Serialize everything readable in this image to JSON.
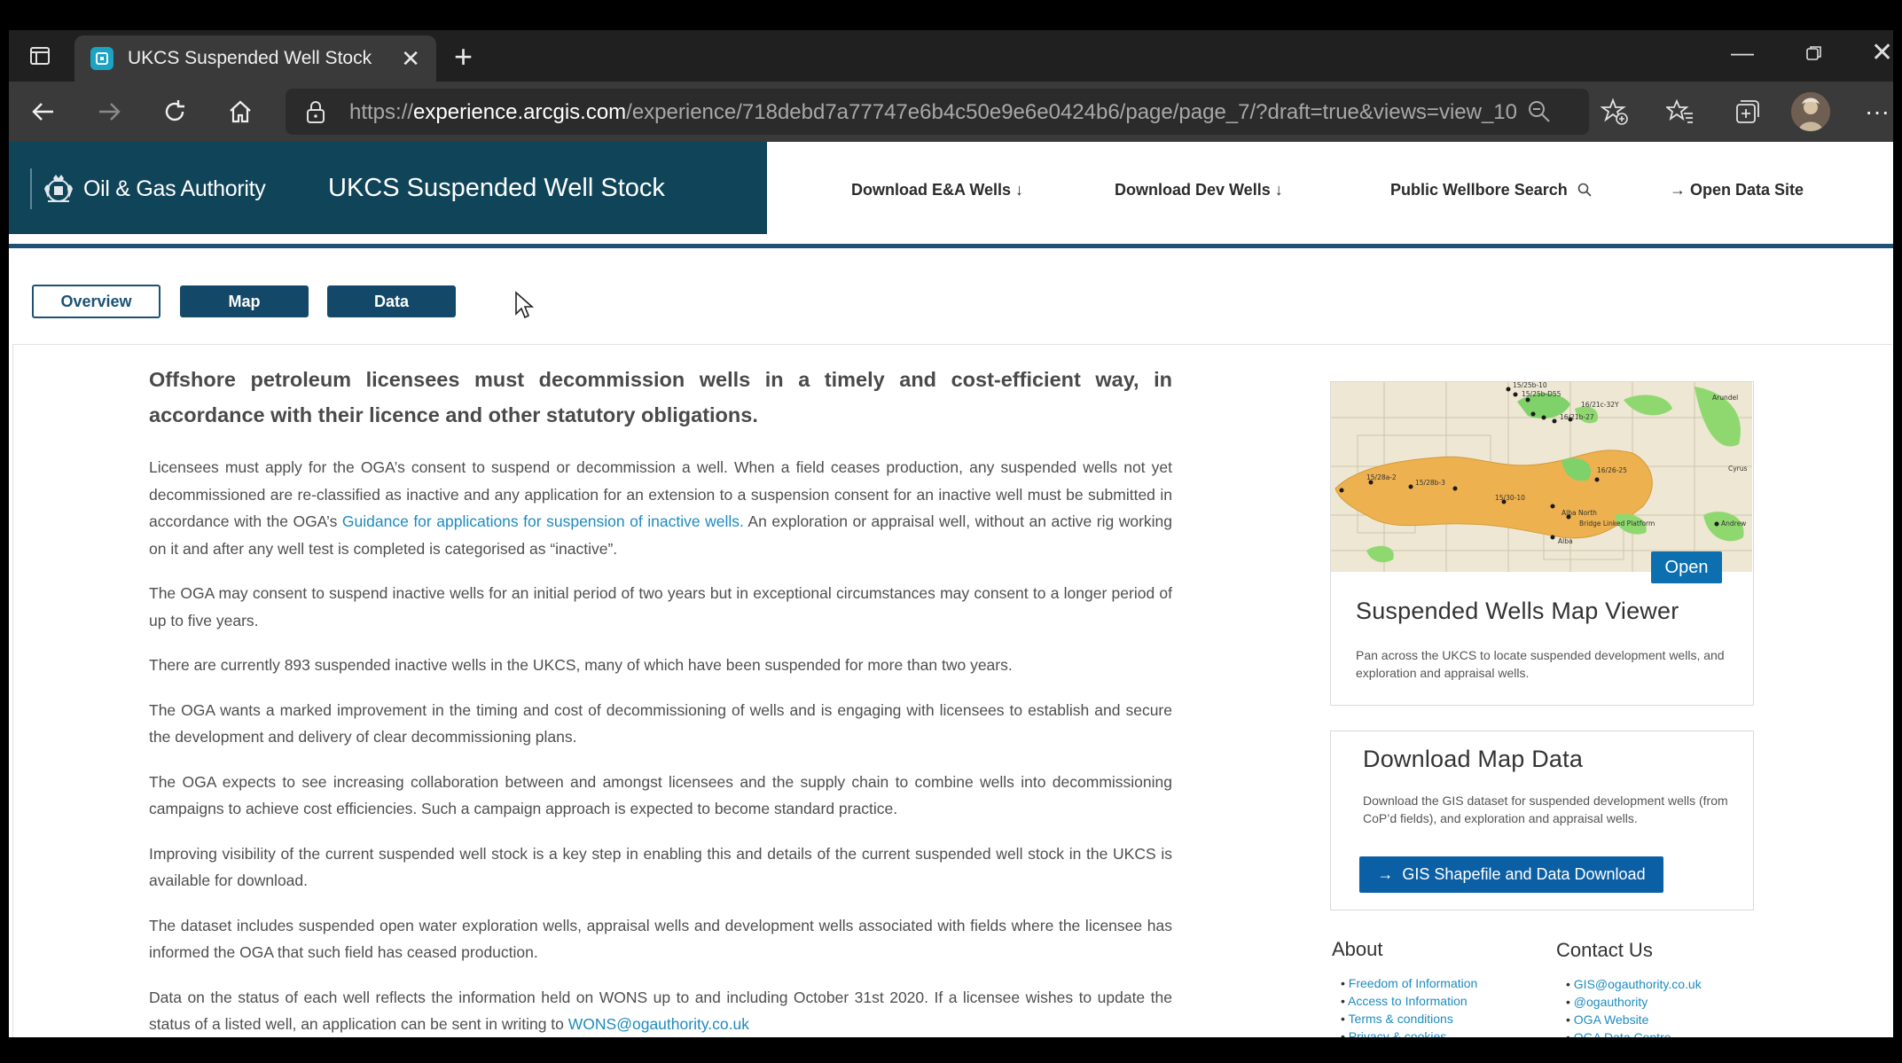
{
  "browser": {
    "tab_title": "UKCS Suspended Well Stock",
    "tab_close": "✕",
    "new_tab": "+",
    "url_prefix": "https://",
    "url_host": "experience.arcgis.com",
    "url_path": "/experience/718debd7a77747e6b4c50e9e6e0424b6/page/page_7/?draft=true&views=view_10"
  },
  "header": {
    "brand": "Oil & Gas Authority",
    "title": "UKCS Suspended Well Stock",
    "band_color": "#0f4459",
    "nav": [
      {
        "label": "Download E&A Wells ↓"
      },
      {
        "label": "Download Dev Wells ↓"
      },
      {
        "label": "Public Wellbore Search"
      },
      {
        "label": "Open Data Site"
      }
    ]
  },
  "page_buttons": {
    "overview": "Overview",
    "map": "Map",
    "data": "Data"
  },
  "article": {
    "lead": "Offshore petroleum licensees must decommission wells in a timely and cost-efficient way, in accordance with their licence and other statutory obligations.",
    "p1_a": "Licensees must apply for the OGA’s consent to suspend or decommission a well. When a field ceases production, any suspended wells not yet decommissioned are re-classified as inactive and any application for an extension to a suspension consent for an inactive well must be submitted in accordance with the OGA’s ",
    "p1_link": "Guidance for applications for suspension of inactive wells.",
    "p1_b": " An exploration or appraisal well, without an active rig working on it and after any well test is completed is categorised as “inactive”.",
    "p2": "The OGA may consent to suspend inactive wells for an initial period of two years but in exceptional circumstances may consent to a longer period of up to five years.",
    "p3": "There are currently 893 suspended inactive wells in the UKCS, many of which have been suspended for more than two years.",
    "p4": "The OGA wants a marked improvement in the timing and cost of decommissioning of wells and is engaging with licensees to establish and secure the development and delivery of clear decommissioning plans.",
    "p5": "The OGA expects to see increasing collaboration between and amongst licensees and the supply chain to combine wells into decommissioning campaigns to achieve cost efficiencies. Such a campaign approach is expected to become standard practice.",
    "p6": "Improving visibility of the current suspended well stock is a key step in enabling this and details of the current suspended well stock in the UKCS is available for download.",
    "p7": "The dataset includes suspended open water exploration wells, appraisal wells and development wells associated with fields where the licensee has informed the OGA that such field has ceased production.",
    "p8": "Data on the status of each well reflects the information held on WONS up to and including October 31st 2020. If a licensee wishes to update",
    "p8_cut": "the status of a listed well, an application can be sent in writing to",
    "p8_link": "WONS@ogauthority.co.uk"
  },
  "map_card": {
    "open_label": "Open",
    "title": "Suspended Wells Map Viewer",
    "desc": "Pan across the UKCS to locate suspended development wells, and exploration and appraisal wells.",
    "map_labels": [
      "15/25b-10",
      "15/25b-D55",
      "16/21c-32Y",
      "16/21b-27",
      "Arundel",
      "15/28a-2",
      "15/28b-3",
      "16/26-25",
      "15/30-10",
      "Alba North",
      "Bridge Linked Platform",
      "Alba",
      "Andrew",
      "Cyrus"
    ]
  },
  "download_card": {
    "title": "Download Map Data",
    "desc": "Download the GIS dataset for suspended development wells (from CoP’d fields), and exploration and appraisal wells.",
    "button": "GIS Shapefile and Data Download"
  },
  "footer": {
    "about_heading": "About",
    "about_links": [
      "Freedom of Information",
      "Access to Information",
      "Terms & conditions",
      "Privacy & cookies"
    ],
    "contact_heading": "Contact Us",
    "contact_links": [
      "GIS@ogauthority.co.uk",
      "@ogauthority",
      "OGA Website",
      "OGA Data Centre"
    ]
  }
}
